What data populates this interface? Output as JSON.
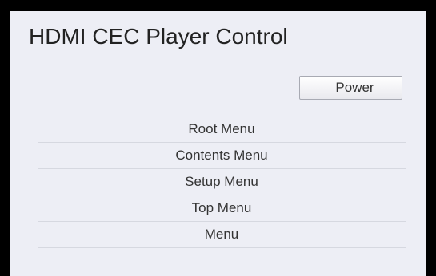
{
  "header": {
    "title": "HDMI CEC Player Control"
  },
  "controls": {
    "power_label": "Power"
  },
  "menu": {
    "items": [
      {
        "label": "Root Menu"
      },
      {
        "label": "Contents Menu"
      },
      {
        "label": "Setup Menu"
      },
      {
        "label": "Top Menu"
      },
      {
        "label": "Menu"
      }
    ]
  },
  "colors": {
    "background": "#000000",
    "panel": "#edeef5",
    "text": "#333333",
    "divider": "#d6d8e0"
  }
}
